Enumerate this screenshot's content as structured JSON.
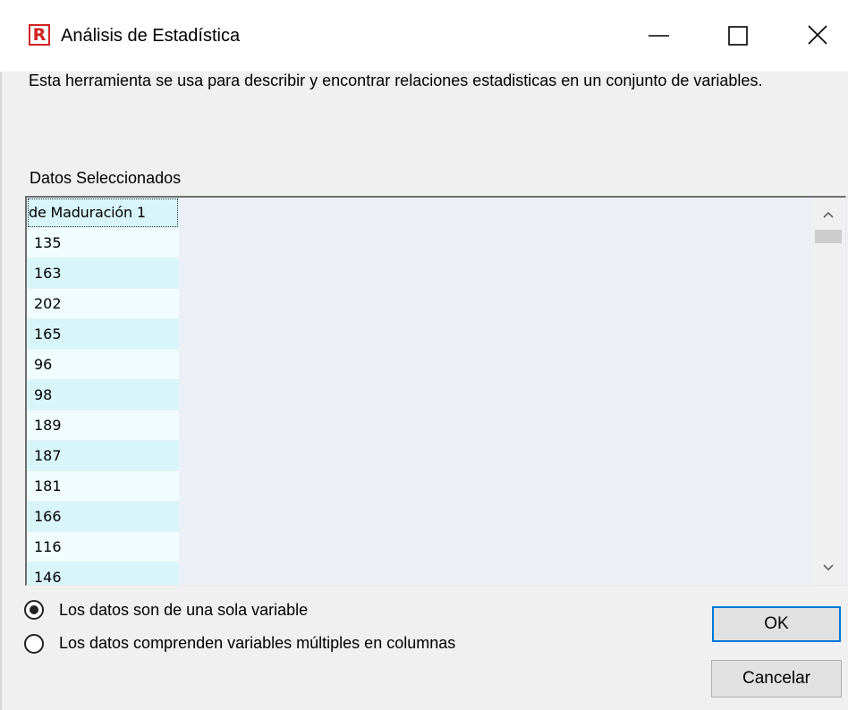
{
  "window": {
    "title": "Análisis de Estadística",
    "app_icon_letter": "R",
    "controls": {
      "minimize": "minimize",
      "maximize": "maximize",
      "close": "close"
    }
  },
  "description": "Esta herramienta se usa para describir y encontrar relaciones estadisticas en un conjunto de variables.",
  "data_section": {
    "label": "Datos Seleccionados",
    "column_header": "de Maduración 1",
    "values": [
      "135",
      "163",
      "202",
      "165",
      "96",
      "98",
      "189",
      "187",
      "181",
      "166",
      "116",
      "146"
    ]
  },
  "options": {
    "single_variable": "Los datos son de una sola variable",
    "multiple_variables": "Los datos comprenden variables múltiples en columnas",
    "selected": "single_variable"
  },
  "buttons": {
    "ok": "OK",
    "cancel": "Cancelar"
  },
  "colors": {
    "accent": "#0078d7",
    "cell_even": "#d8f6f9",
    "cell_odd": "#f0fcfd",
    "icon_red": "#d22222"
  }
}
